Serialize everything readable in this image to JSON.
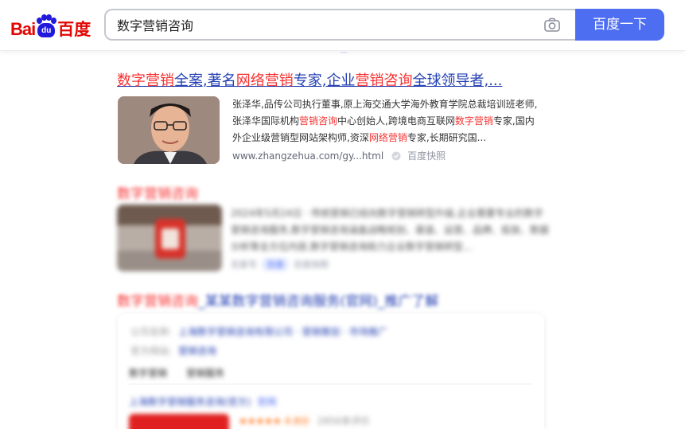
{
  "header": {
    "logo_text_latin": "Bai",
    "logo_paw_text": "du",
    "logo_text_cn": "百度",
    "search_value": "数字营销咨询",
    "search_button": "百度一下"
  },
  "result1": {
    "title_parts": [
      "数字营销",
      "全案,著名",
      "网络营销",
      "专家,企业",
      "营销咨询",
      "全球领导者,..."
    ],
    "snippet_line1": "张泽华,品传公司执行董事,原上海交通大学海外教育学院总裁培训班老师,",
    "snippet_line2_a": "张泽华国际机构",
    "snippet_line2_em": "营销咨询",
    "snippet_line2_b": "中心创始人,跨境电商互联网",
    "snippet_line2_em2": "数字营销",
    "snippet_line2_c": "专家,国内",
    "snippet_line3_a": "外企业级营销型网站架构师,资深",
    "snippet_line3_em": "网络营销",
    "snippet_line3_b": "专家,长期研究国...",
    "url": "www.zhangzehua.com/gy...html",
    "snapshot": "百度快照"
  },
  "result2": {
    "title": "数字营销咨询",
    "snippet_line1": "2024年5月24日 · 传统营销已经向数字营销转型升级,企业需要专业的数字",
    "snippet_line2": "营销咨询服务,数字营销咨询涵盖战略规划、渠道、运营、品牌、投放、数据",
    "snippet_line3": "分析等全方位内容,数字营销咨询助力企业数字营销转型...",
    "meta_site": "百家号",
    "meta_chip": "百度",
    "meta_snapshot": "百度快照"
  },
  "result3": {
    "title_em": "数字营销咨询",
    "title_rest": "_某某数字营销咨询服务(官网)_推广了解",
    "row1_label": "公司名称:",
    "row1_link": "上海数字营销咨询有限公司 · 营销策划 · 市场推广",
    "row2_label": "官方网站:",
    "row2_link": "营销咨询",
    "tab1": "数字营销",
    "tab2": "营销服务",
    "sub_title": "上海数字营销服务咨询(官方)",
    "sub_tag": "官网",
    "rating": "★★★★★ 4.8分",
    "rating_count": "2856条评价"
  }
}
